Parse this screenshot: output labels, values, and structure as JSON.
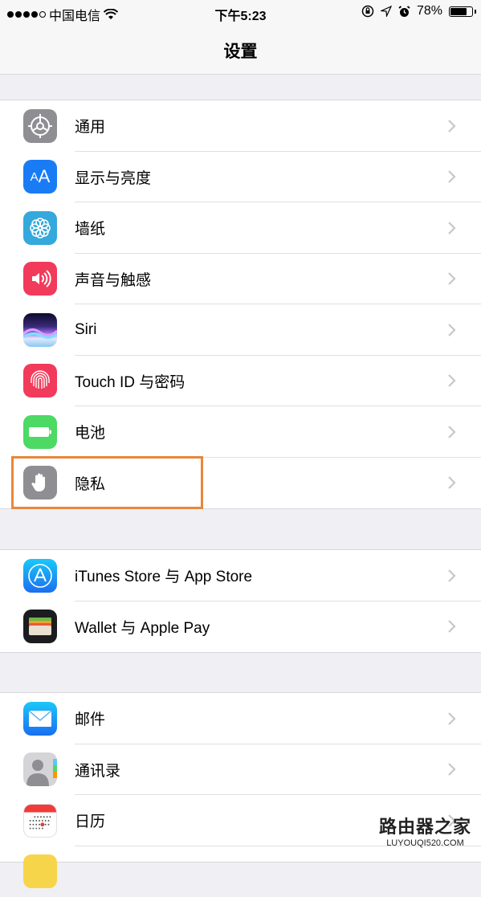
{
  "status_bar": {
    "signal_bars_filled": 4,
    "signal_bars_total": 5,
    "carrier": "中国电信",
    "time": "下午5:23",
    "battery_percent_label": "78%",
    "battery_level": 0.78,
    "icons": [
      "orientation-lock-icon",
      "location-icon",
      "alarm-icon"
    ]
  },
  "nav": {
    "title": "设置"
  },
  "groups": [
    {
      "items": [
        {
          "label": "通用",
          "icon": "gear-icon",
          "color": "#8e8e93"
        },
        {
          "label": "显示与亮度",
          "icon": "text-size-icon",
          "color": "#1a7cf5"
        },
        {
          "label": "墙纸",
          "icon": "flower-icon",
          "color": "#35a8dc"
        },
        {
          "label": "声音与触感",
          "icon": "speaker-icon",
          "color": "#f23a5a"
        },
        {
          "label": "Siri",
          "icon": "siri-icon",
          "color": "#1a1a3a"
        },
        {
          "label": "Touch ID 与密码",
          "icon": "fingerprint-icon",
          "color": "#f23a5a"
        },
        {
          "label": "电池",
          "icon": "battery-icon",
          "color": "#4cd964"
        },
        {
          "label": "隐私",
          "icon": "hand-icon",
          "color": "#8e8e93",
          "highlighted": true
        }
      ]
    },
    {
      "items": [
        {
          "label": "iTunes Store 与 App Store",
          "icon": "app-store-icon",
          "color": "#1f8ef1"
        },
        {
          "label": "Wallet 与 Apple Pay",
          "icon": "wallet-icon",
          "color": "#1c1c1e"
        }
      ]
    },
    {
      "items": [
        {
          "label": "邮件",
          "icon": "mail-icon",
          "color": "#1f8ef1"
        },
        {
          "label": "通讯录",
          "icon": "contacts-icon",
          "color": "#c7c7cc"
        },
        {
          "label": "日历",
          "icon": "calendar-icon",
          "color": "#ffffff"
        },
        {
          "label": "",
          "icon": "notes-icon",
          "color": "#f7d54a"
        }
      ]
    }
  ],
  "highlight_color": "#e8873a",
  "watermark": {
    "title": "路由器之家",
    "subtitle": "LUYOUQI520.COM"
  }
}
